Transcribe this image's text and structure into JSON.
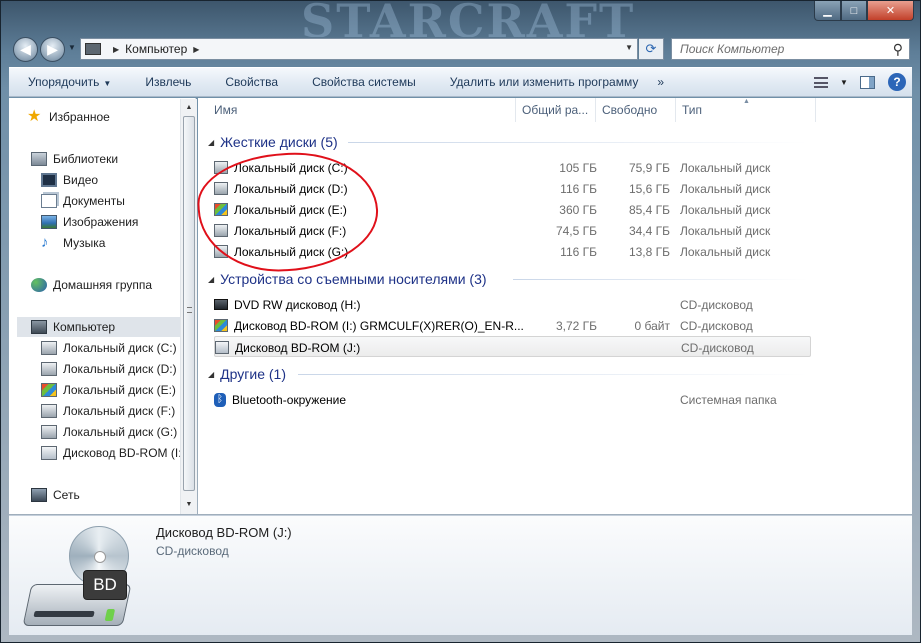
{
  "window": {
    "background_art_text": "STARCRAFT",
    "caption": {
      "minimize": "▁",
      "maximize": "□",
      "close": "✕"
    }
  },
  "nav": {
    "back_icon": "arrow-left-icon",
    "forward_icon": "arrow-right-icon"
  },
  "address": {
    "crumb": "Компьютер"
  },
  "search": {
    "placeholder": "Поиск Компьютер"
  },
  "toolbar": {
    "organize": "Упорядочить",
    "eject": "Извлечь",
    "properties": "Свойства",
    "system_properties": "Свойства системы",
    "uninstall": "Удалить или изменить программу",
    "more": "»"
  },
  "sidebar": {
    "favorites": "Избранное",
    "libraries": "Библиотеки",
    "video": "Видео",
    "documents": "Документы",
    "images": "Изображения",
    "music": "Музыка",
    "homegroup": "Домашняя группа",
    "computer": "Компьютер",
    "drives": [
      "Локальный диск (C:)",
      "Локальный диск (D:)",
      "Локальный диск (E:)",
      "Локальный диск (F:)",
      "Локальный диск (G:)",
      "Дисковод BD-ROM (I:)"
    ],
    "network": "Сеть"
  },
  "columns": {
    "name": "Имя",
    "total": "Общий ра...",
    "free": "Свободно",
    "type": "Тип"
  },
  "groups": {
    "hard": "Жесткие диски (5)",
    "removable": "Устройства со съемными носителями (3)",
    "other": "Другие (1)"
  },
  "hard_drives": [
    {
      "name": "Локальный диск (C:)",
      "total": "105 ГБ",
      "free": "75,9 ГБ",
      "type": "Локальный диск"
    },
    {
      "name": "Локальный диск (D:)",
      "total": "116 ГБ",
      "free": "15,6 ГБ",
      "type": "Локальный диск"
    },
    {
      "name": "Локальный диск (E:)",
      "total": "360 ГБ",
      "free": "85,4 ГБ",
      "type": "Локальный диск"
    },
    {
      "name": "Локальный диск (F:)",
      "total": "74,5 ГБ",
      "free": "34,4 ГБ",
      "type": "Локальный диск"
    },
    {
      "name": "Локальный диск (G:)",
      "total": "116 ГБ",
      "free": "13,8 ГБ",
      "type": "Локальный диск"
    }
  ],
  "removable": [
    {
      "name": "DVD RW дисковод (H:)",
      "total": "",
      "free": "",
      "type": "CD-дисковод"
    },
    {
      "name": "Дисковод BD-ROM (I:) GRMCULF(X)RER(O)_EN-R...",
      "total": "3,72 ГБ",
      "free": "0 байт",
      "type": "CD-дисковод"
    },
    {
      "name": "Дисковод BD-ROM (J:)",
      "total": "",
      "free": "",
      "type": "CD-дисковод"
    }
  ],
  "other": [
    {
      "name": "Bluetooth-окружение",
      "type": "Системная папка"
    }
  ],
  "details": {
    "title": "Дисковод BD-ROM (J:)",
    "subtitle": "CD-дисковод",
    "badge": "BD"
  },
  "colors": {
    "annotation": "#e0101a",
    "group_header": "#1e3287",
    "toolbar_text": "#1e3959"
  }
}
